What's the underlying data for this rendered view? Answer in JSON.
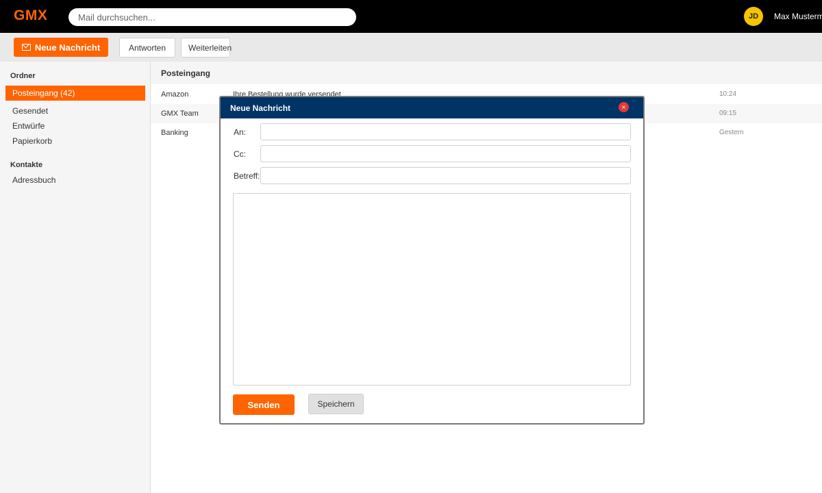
{
  "header": {
    "logo": "GMX",
    "search_placeholder": "Mail durchsuchen...",
    "avatar_initials": "JD",
    "user_name": "Max Mustermann"
  },
  "toolbar": {
    "new_message_label": "Neue Nachricht",
    "reply_label": "Antworten",
    "forward_label": "Weiterleiten"
  },
  "sidebar": {
    "folders_heading": "Ordner",
    "folders": [
      {
        "label": "Posteingang (42)",
        "active": true
      },
      {
        "label": "Gesendet",
        "active": false
      },
      {
        "label": "Entwürfe",
        "active": false
      },
      {
        "label": "Papierkorb",
        "active": false
      }
    ],
    "contacts_heading": "Kontakte",
    "contacts": [
      {
        "label": "Adressbuch"
      }
    ]
  },
  "inbox": {
    "title": "Posteingang",
    "messages": [
      {
        "sender": "Amazon",
        "subject": "Ihre Bestellung wurde versendet",
        "time": "10:24"
      },
      {
        "sender": "GMX Team",
        "subject": "",
        "time": "09:15"
      },
      {
        "sender": "Banking",
        "subject": "",
        "time": "Gestern"
      }
    ]
  },
  "compose": {
    "title": "Neue Nachricht",
    "close_glyph": "×",
    "to_label": "An:",
    "cc_label": "Cc:",
    "subject_label": "Betreff:",
    "to_value": "",
    "cc_value": "",
    "subject_value": "",
    "body_value": "",
    "send_label": "Senden",
    "save_label": "Speichern"
  },
  "colors": {
    "brand_orange": "#ff6400",
    "dialog_header": "#003366",
    "avatar_yellow": "#f5c400",
    "close_red": "#e53935"
  }
}
